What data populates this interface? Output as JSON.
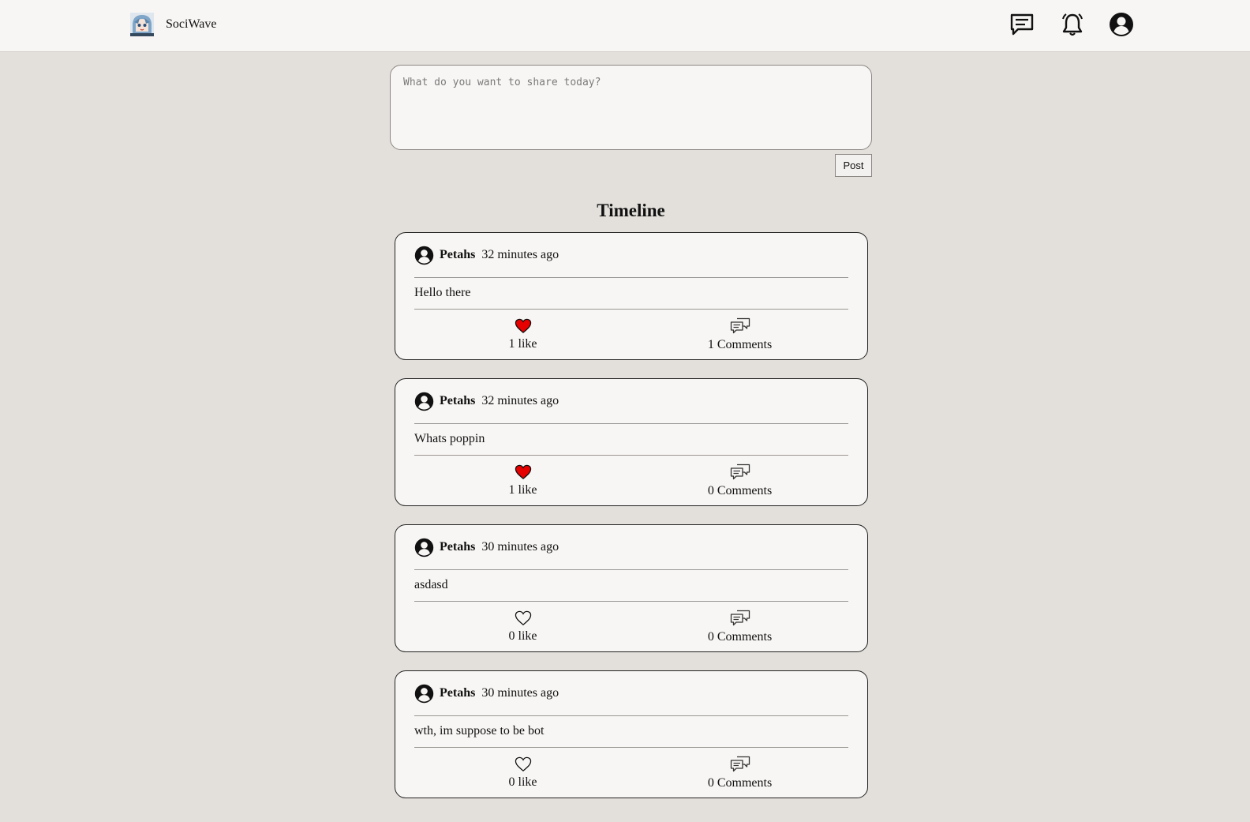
{
  "header": {
    "brand_name": "SociWave",
    "logo_icon": "anime-avatar-logo",
    "icons": [
      "messages-icon",
      "bell-icon",
      "profile-icon"
    ]
  },
  "composer": {
    "placeholder": "What do you want to share today?",
    "value": "",
    "post_label": "Post"
  },
  "timeline": {
    "title": "Timeline",
    "posts": [
      {
        "author": "Petahs",
        "time": "32 minutes ago",
        "text": "Hello there",
        "likes_label": "1 like",
        "liked": true,
        "comments_label": "1 Comments"
      },
      {
        "author": "Petahs",
        "time": "32 minutes ago",
        "text": "Whats poppin",
        "likes_label": "1 like",
        "liked": true,
        "comments_label": "0 Comments"
      },
      {
        "author": "Petahs",
        "time": "30 minutes ago",
        "text": "asdasd",
        "likes_label": "0 like",
        "liked": false,
        "comments_label": "0 Comments"
      },
      {
        "author": "Petahs",
        "time": "30 minutes ago",
        "text": "wth, im suppose to be bot",
        "likes_label": "0 like",
        "liked": false,
        "comments_label": "0 Comments"
      }
    ]
  },
  "colors": {
    "page_bg": "#e3e0db",
    "card_bg": "#f8f6f4",
    "liked_heart": "#e60000"
  }
}
